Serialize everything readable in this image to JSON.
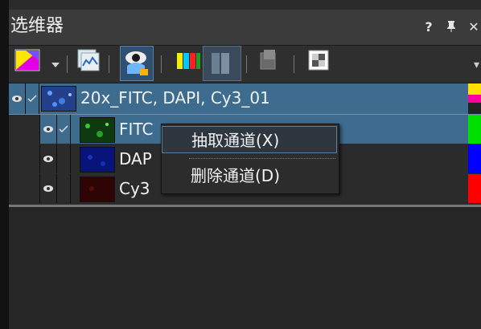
{
  "window": {
    "title": "选维器",
    "actions": [
      {
        "icon": "help-icon",
        "label": "?"
      },
      {
        "icon": "pin-icon",
        "label": "ᴾ"
      },
      {
        "icon": "close-icon",
        "label": "✕"
      }
    ]
  },
  "toolbar": {
    "tools": [
      {
        "icon": "color-picker-icon"
      },
      {
        "icon": "dropdown-arrow-icon"
      },
      {
        "icon": "image-view-icon"
      },
      {
        "icon": "eye-icon",
        "active": true
      },
      {
        "icon": "channel-bars-icon"
      },
      {
        "icon": "channel-split-icon",
        "active": true
      },
      {
        "icon": "extract-icon"
      },
      {
        "icon": "grid-icon"
      }
    ]
  },
  "tree": {
    "parent": {
      "label": "20x_FITC, DAPI, Cy3_01",
      "visible": true,
      "checked": true,
      "thumb_color": "#3a5aa0"
    },
    "channels": [
      {
        "label": "FITC",
        "visible": true,
        "checked": true,
        "thumb_color": "#1e5a1e",
        "swatch": "#00e000",
        "selected": true
      },
      {
        "label": "DAP",
        "visible": true,
        "checked": false,
        "thumb_color": "#0a1a8a",
        "swatch": "#0000ff",
        "selected": false
      },
      {
        "label": "Cy3",
        "visible": true,
        "checked": false,
        "thumb_color": "#3a0505",
        "swatch": "#ff0000",
        "selected": false
      }
    ]
  },
  "context_menu": {
    "items": [
      {
        "label": "抽取通道(X)",
        "hover": true
      },
      {
        "label": "删除通道(D)",
        "hover": false
      }
    ]
  }
}
